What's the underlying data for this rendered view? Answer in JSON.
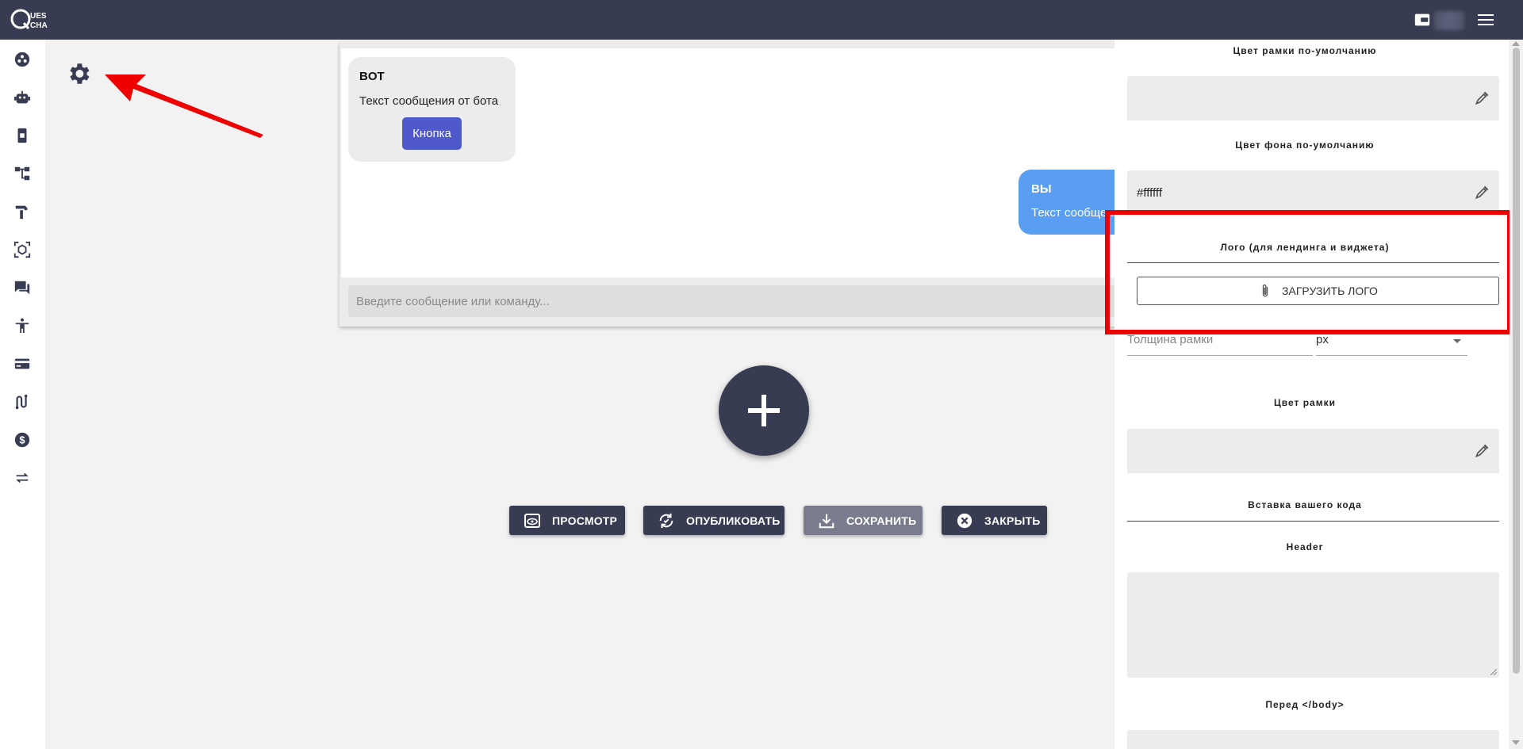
{
  "app": {
    "logo_letters": [
      "Q",
      "UES",
      "CHA"
    ]
  },
  "sidebar": {
    "items": [
      {
        "icon": "dashboard-icon"
      },
      {
        "icon": "robot-icon"
      },
      {
        "icon": "phone-app-icon"
      },
      {
        "icon": "flow-diagram-icon"
      },
      {
        "icon": "hammer-icon"
      },
      {
        "icon": "cube-scan-icon"
      },
      {
        "icon": "chat-icon"
      },
      {
        "icon": "accessibility-icon"
      },
      {
        "icon": "credit-card-icon"
      },
      {
        "icon": "route-icon"
      },
      {
        "icon": "dollar-icon"
      },
      {
        "icon": "swap-arrows-icon"
      }
    ]
  },
  "chat_preview": {
    "bot_name": "BOT",
    "bot_message": "Текст сообщения от бота",
    "bot_button": "Кнопка",
    "user_name": "ВЫ",
    "user_message": "Текст сообщения",
    "input_placeholder": "Введите сообщение или команду..."
  },
  "actions": {
    "preview": "ПРОСМОТР",
    "publish": "ОПУБЛИКОВАТЬ",
    "save": "СОХРАНИТЬ",
    "close": "ЗАКРЫТЬ"
  },
  "settings_panel": {
    "default_border_color_label": "Цвет рамки по-умолчанию",
    "default_border_color_value": "",
    "default_bg_color_label": "Цвет фона по-умолчанию",
    "default_bg_color_value": "#ffffff",
    "logo_label": "Лого (для лендинга и виджета)",
    "upload_logo_button": "ЗАГРУЗИТЬ ЛОГО",
    "border_width_placeholder": "Толщина рамки",
    "border_unit": "px",
    "border_color_label": "Цвет рамки",
    "border_color_value": "",
    "custom_code_label": "Вставка вашего кода",
    "header_label": "Header",
    "before_body_label": "Перед </body>"
  },
  "colors": {
    "brand_dark": "#383c52",
    "bot_button": "#5059c9",
    "user_bubble": "#5a9ef4",
    "highlight": "#ee0000"
  }
}
